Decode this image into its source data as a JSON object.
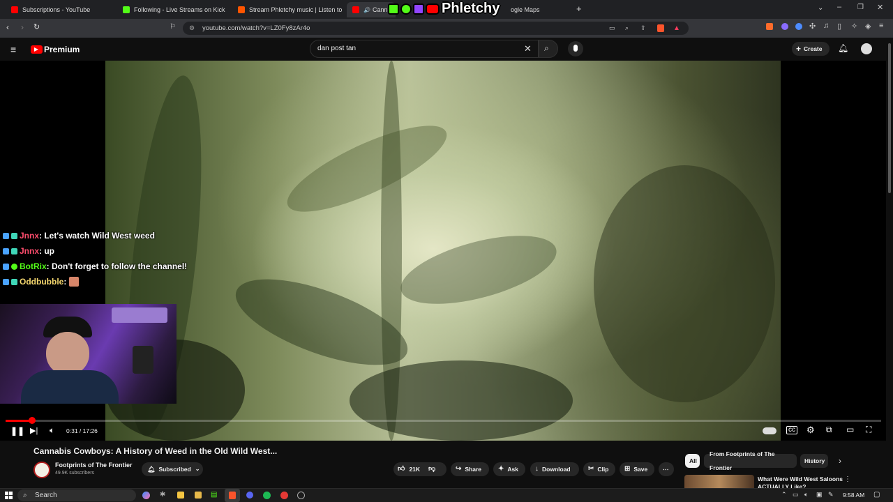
{
  "browser": {
    "tabs": [
      {
        "title": "Subscriptions - YouTube",
        "color": "#ff0000"
      },
      {
        "title": "Following - Live Streams on Kick",
        "color": "#53fc18"
      },
      {
        "title": "Stream Phletchy music | Listen to son",
        "color": "#ff5500"
      },
      {
        "title": "Cannab",
        "color": "#ff0000"
      },
      {
        "title": "ogle Maps",
        "color": "#34a853"
      }
    ],
    "overlay_brand": "Phletchy",
    "url": "youtube.com/watch?v=LZ0Fy8zAr4o"
  },
  "youtube": {
    "logo_label": "Premium",
    "search_value": "dan post tan",
    "create_label": "Create"
  },
  "chat": [
    {
      "user": "Jnnx",
      "user_color": "#ff4d6d",
      "message": ": Let's watch Wild West weed"
    },
    {
      "user": "Jnnx",
      "user_color": "#ff4d6d",
      "message": ": up"
    },
    {
      "user": "BotRix",
      "user_color": "#53fc18",
      "message": ": Don't forget to follow the channel!"
    },
    {
      "user": "Oddbubble",
      "user_color": "#f5d76e",
      "message": ":"
    }
  ],
  "player": {
    "time": "0:31 / 17:26",
    "progress_fraction": 0.03
  },
  "video": {
    "title": "Cannabis Cowboys: A History of Weed in the Old Wild West...",
    "channel": "Footprints of The Frontier",
    "subscribers": "49.9K subscribers",
    "subscribed_label": "Subscribed",
    "likes": "21K",
    "share_label": "Share",
    "ask_label": "Ask",
    "download_label": "Download",
    "clip_label": "Clip",
    "save_label": "Save"
  },
  "sidebar": {
    "chips": [
      "All",
      "From Footprints of The Frontier",
      "History"
    ],
    "rec_title": "What Were Wild West Saloons ACTUALLY Like?"
  },
  "taskbar": {
    "search_placeholder": "Search",
    "clock": "9:58 AM"
  }
}
